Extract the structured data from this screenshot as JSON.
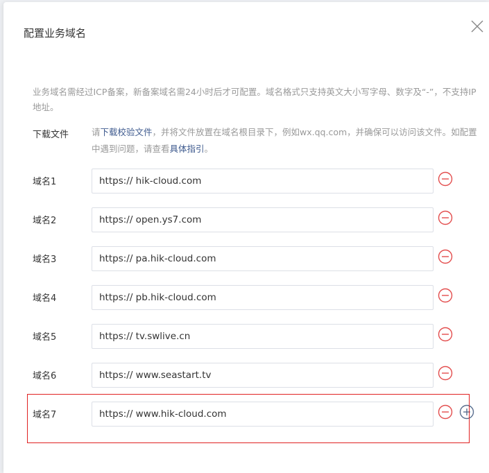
{
  "dialog": {
    "title": "配置业务域名",
    "close_icon": "close-icon"
  },
  "notice": "业务域名需经过ICP备案，新备案域名需24小时后才可配置。域名格式只支持英文大小写字母、数字及“-”，不支持IP地址。",
  "download": {
    "label": "下载文件",
    "text_before_link": "请",
    "link_text": "下载校验文件",
    "text_middle": "，并将文件放置在域名根目录下，例如wx.qq.com，并确保可以访问该文件。如配置中遇到问题，请查看",
    "guide_link_text": "具体指引",
    "text_end": "。"
  },
  "domains": [
    {
      "label": "域名1",
      "value": "https:// hik-cloud.com"
    },
    {
      "label": "域名2",
      "value": "https:// open.ys7.com"
    },
    {
      "label": "域名3",
      "value": "https:// pa.hik-cloud.com"
    },
    {
      "label": "域名4",
      "value": "https:// pb.hik-cloud.com"
    },
    {
      "label": "域名5",
      "value": "https:// tv.swlive.cn"
    },
    {
      "label": "域名6",
      "value": "https:// www.seastart.tv"
    },
    {
      "label": "域名7",
      "value": "https:// www.hik-cloud.com"
    }
  ],
  "icons": {
    "remove": "minus-circle-icon",
    "add": "plus-circle-icon"
  },
  "colors": {
    "remove_icon": "#e34d4d",
    "add_icon": "#5a6e8e",
    "link": "#3e5a8e",
    "highlight": "#e02020"
  }
}
